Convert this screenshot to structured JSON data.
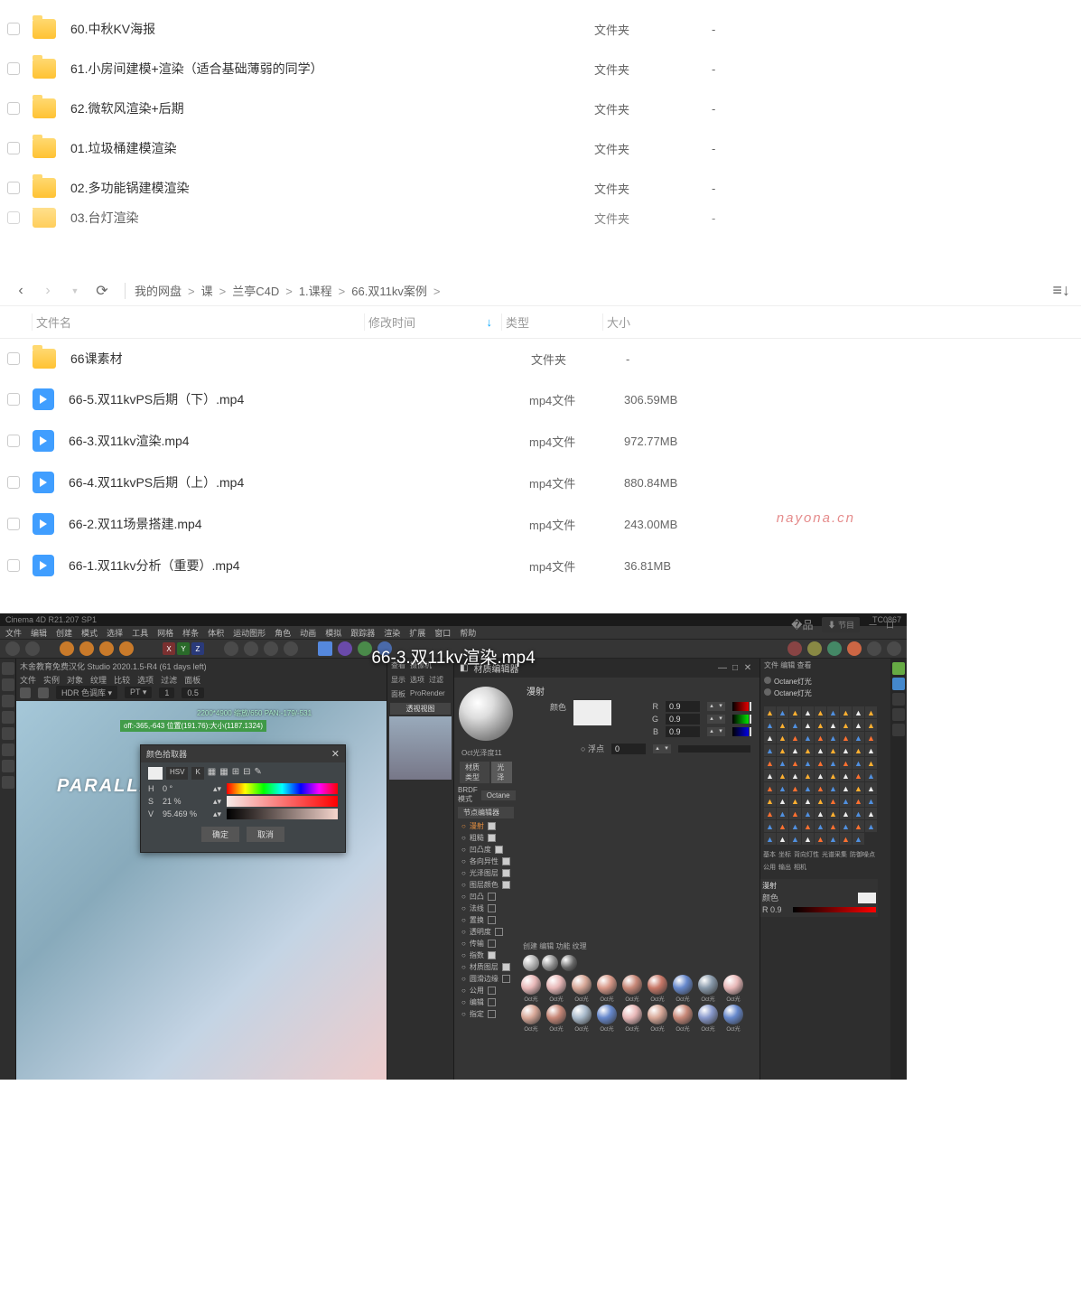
{
  "upper_files": [
    {
      "name": "60.中秋KV海报",
      "type": "文件夹",
      "size": "-",
      "icon": "folder"
    },
    {
      "name": "61.小房间建模+渲染（适合基础薄弱的同学）",
      "type": "文件夹",
      "size": "-",
      "icon": "folder"
    },
    {
      "name": "62.微软风渲染+后期",
      "type": "文件夹",
      "size": "-",
      "icon": "folder"
    },
    {
      "name": "01.垃圾桶建模渲染",
      "type": "文件夹",
      "size": "-",
      "icon": "folder"
    },
    {
      "name": "02.多功能锅建模渲染",
      "type": "文件夹",
      "size": "-",
      "icon": "folder"
    },
    {
      "name": "03.台灯渲染",
      "type": "文件夹",
      "size": "-",
      "icon": "folder",
      "cut": true
    }
  ],
  "breadcrumb": {
    "items": [
      "我的网盘",
      "课",
      "兰亭C4D",
      "1.课程",
      "66.双11kv案例"
    ],
    "sep": ">"
  },
  "columns": {
    "name": "文件名",
    "date": "修改时间",
    "type": "类型",
    "size": "大小"
  },
  "lower_files": [
    {
      "name": "66课素材",
      "type": "文件夹",
      "size": "-",
      "icon": "folder"
    },
    {
      "name": "66-5.双11kvPS后期（下）.mp4",
      "type": "mp4文件",
      "size": "306.59MB",
      "icon": "video"
    },
    {
      "name": "66-3.双11kv渲染.mp4",
      "type": "mp4文件",
      "size": "972.77MB",
      "icon": "video"
    },
    {
      "name": "66-4.双11kvPS后期（上）.mp4",
      "type": "mp4文件",
      "size": "880.84MB",
      "icon": "video"
    },
    {
      "name": "66-2.双11场景搭建.mp4",
      "type": "mp4文件",
      "size": "243.00MB",
      "icon": "video"
    },
    {
      "name": "66-1.双11kv分析（重要）.mp4",
      "type": "mp4文件",
      "size": "36.81MB",
      "icon": "video"
    }
  ],
  "watermark": "nayona.cn",
  "c4d": {
    "title_left": "Cinema 4D R21.207 SP1",
    "title_right": "TC0867",
    "video_title": "66-3.双11kv渲染.mp4",
    "menu": [
      "文件",
      "编辑",
      "创建",
      "模式",
      "选择",
      "工具",
      "网格",
      "样条",
      "体积",
      "运动图形",
      "角色",
      "动画",
      "模拟",
      "跟踪器",
      "渲染",
      "扩展",
      "窗口",
      "帮助"
    ],
    "studio_bar": "木舍教育免费汉化 Studio 2020.1.5-R4 (61 days left)",
    "sub_menu": [
      "文件",
      "实例",
      "对象",
      "纹理",
      "比较",
      "选项",
      "过滤",
      "面板"
    ],
    "hdr_settings": {
      "hdr": "HDR 色调库",
      "pt": "PT",
      "one": "1",
      "val": "0.5"
    },
    "vp_info": "2200*4900 缩放/650  PAN:-179/-531",
    "vp_green": "off:-365,-643 位置(191.76):大小(1187.1324)",
    "vp_parallax": "PARALLA",
    "preview_menu": [
      "查看",
      "摄像机",
      "显示",
      "选项",
      "过滤",
      "面板",
      "ProRender"
    ],
    "preview_tab": "透视视图",
    "material_name": "Oct光泽度11",
    "attr_panel": {
      "title": "材质编辑器",
      "section": "漫射",
      "color_label": "颜色",
      "r": "0.9",
      "g": "0.9",
      "b": "0.9",
      "float_label": "浮点",
      "float_val": "0",
      "tabs": [
        "材质类型",
        "光泽"
      ],
      "brdf_label": "BRDF 模式",
      "brdf_val": "Octane",
      "node_label": "节点编辑器",
      "tree": [
        {
          "label": "漫射",
          "active": true,
          "on": true
        },
        {
          "label": "粗糙",
          "on": true
        },
        {
          "label": "凹凸度",
          "on": true
        },
        {
          "label": "各向异性",
          "on": true
        },
        {
          "label": "光泽图层",
          "on": true
        },
        {
          "label": "图层颜色",
          "on": true
        },
        {
          "label": "凹凸",
          "on": false
        },
        {
          "label": "法线",
          "on": false
        },
        {
          "label": "置换",
          "on": false
        },
        {
          "label": "透明度",
          "on": false
        },
        {
          "label": "传输",
          "on": false
        },
        {
          "label": "指数",
          "on": true
        },
        {
          "label": "材质图层",
          "on": true
        },
        {
          "label": "圆滑边缘",
          "on": false
        },
        {
          "label": "公用",
          "on": false
        },
        {
          "label": "编辑",
          "on": false
        },
        {
          "label": "指定",
          "on": false
        }
      ]
    },
    "color_picker": {
      "title": "颜色拾取器",
      "modes": [
        "HSV",
        "K"
      ],
      "h_label": "H",
      "h": "0 °",
      "s_label": "S",
      "s": "21 %",
      "v_label": "V",
      "v": "95.469 %",
      "ok": "确定",
      "cancel": "取消"
    },
    "right": {
      "oct_items": [
        "Octane灯光",
        "Octane灯光"
      ],
      "tabs_top": [
        "基本",
        "坐标",
        "背向灯性",
        "光谱采集",
        "防御噪点"
      ],
      "tabs_bot": [
        "公用",
        "输出",
        "相机"
      ]
    },
    "bottom_section": {
      "label": "漫射",
      "color": "颜色",
      "r": "R 0.9"
    },
    "mat_labels": [
      "Oct光",
      "Oct光",
      "Oct光",
      "Oct光",
      "Oct光",
      "Oct光",
      "Oct光",
      "Oct光",
      "Oct光",
      "Oct光",
      "Oct光",
      "Oct光",
      "Oct光",
      "Oct光",
      "Oct光",
      "Oct光",
      "Oct光",
      "Oct光"
    ]
  }
}
